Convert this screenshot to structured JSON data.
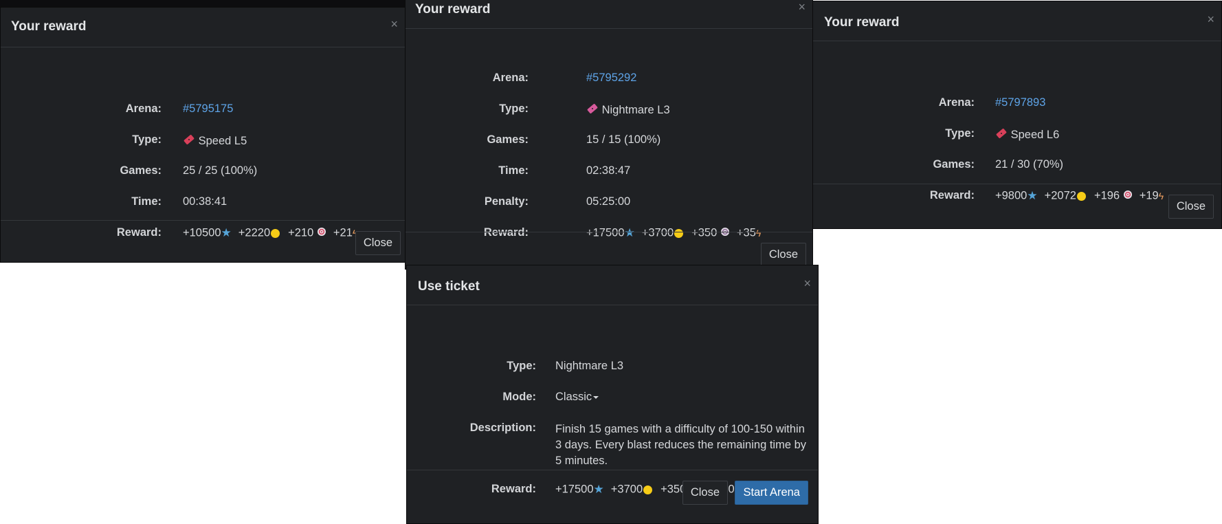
{
  "modals": {
    "reward1": {
      "title": "Your reward",
      "close_x": "×",
      "arena_label": "Arena:",
      "arena_value": "#5795175",
      "type_label": "Type:",
      "type_value": "Speed L5",
      "games_label": "Games:",
      "games_value": "25 / 25 (100%)",
      "time_label": "Time:",
      "time_value": "00:38:41",
      "reward_label": "Reward:",
      "reward": {
        "stars": "+10500",
        "coins": "+2220",
        "targets": "+210",
        "energy": "+21"
      },
      "close_button": "Close"
    },
    "reward2": {
      "title": "Your reward",
      "close_x": "×",
      "arena_label": "Arena:",
      "arena_value": "#5795292",
      "type_label": "Type:",
      "type_value": "Nightmare L3",
      "games_label": "Games:",
      "games_value": "15 / 15 (100%)",
      "time_label": "Time:",
      "time_value": "02:38:47",
      "penalty_label": "Penalty:",
      "penalty_value": "05:25:00",
      "reward_label": "Reward:",
      "reward": {
        "stars": "+17500",
        "coins": "+3700",
        "targets": "+350",
        "energy": "+35"
      },
      "close_button": "Close"
    },
    "reward3": {
      "title": "Your reward",
      "close_x": "×",
      "arena_label": "Arena:",
      "arena_value": "#5797893",
      "type_label": "Type:",
      "type_value": "Speed L6",
      "games_label": "Games:",
      "games_value": "21 / 30 (70%)",
      "reward_label": "Reward:",
      "reward": {
        "stars": "+9800",
        "coins": "+2072",
        "targets": "+196",
        "energy": "+19"
      },
      "close_button": "Close"
    },
    "ticket": {
      "title": "Use ticket",
      "close_x": "×",
      "type_label": "Type:",
      "type_value": "Nightmare L3",
      "mode_label": "Mode:",
      "mode_value": "Classic",
      "description_label": "Description:",
      "description_value": "Finish 15 games with a difficulty of 100-150 within 3 days. Every blast reduces the remaining time by 5 minutes.",
      "reward_label": "Reward:",
      "reward": {
        "stars": "+17500",
        "coins": "+3700",
        "targets": "+350",
        "energy": "+35.0"
      },
      "close_button": "Close",
      "start_button": "Start Arena"
    }
  },
  "colors": {
    "modal_bg": "#1f2124",
    "link": "#5ea4e8",
    "coin": "#f6cc17",
    "star": "#55a4d8",
    "primary_button": "#2e6ca8",
    "ticket_icon": "#d9405a"
  },
  "icons": {
    "ticket": "ticket-icon",
    "star": "star-icon",
    "coin": "coin-icon",
    "target": "target-icon",
    "energy": "lightning-icon"
  }
}
